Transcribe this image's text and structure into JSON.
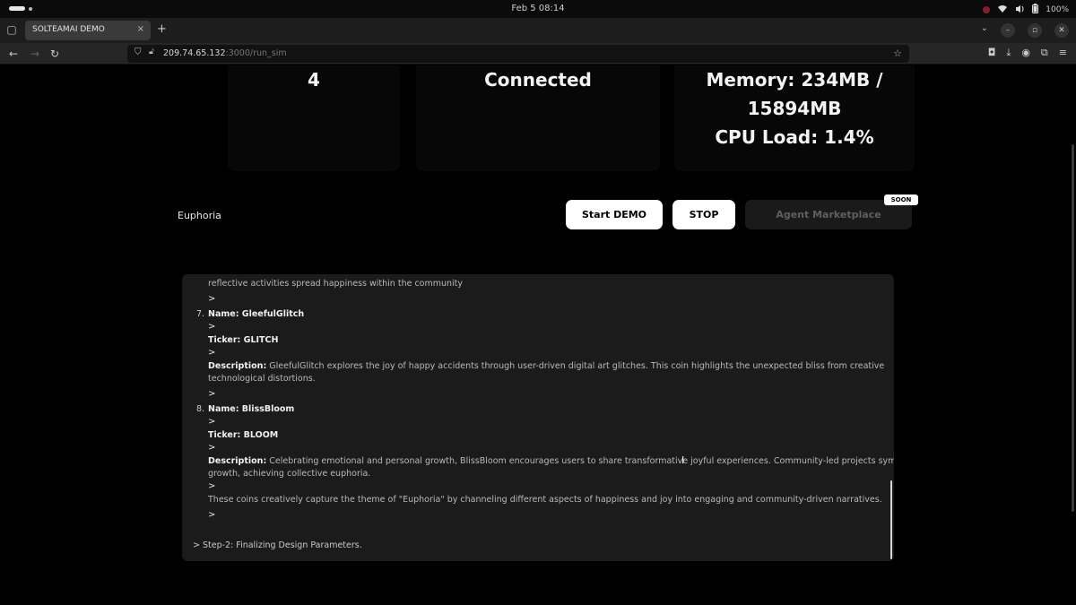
{
  "os": {
    "clock": "Feb 5  08:14",
    "battery": "100%"
  },
  "browser": {
    "tab_title": "SOLTEAMAI DEMO",
    "tab_close": "×",
    "new_tab": "+",
    "url_host": "209.74.65.132",
    "url_rest": ":3000/run_sim"
  },
  "stats": {
    "agents": "4",
    "connection": "Connected",
    "memory_line1": "Memory: 234MB /",
    "memory_line2": "15894MB",
    "cpu": "CPU Load: 1.4%"
  },
  "controls": {
    "topic": "Euphoria",
    "start_label": "Start DEMO",
    "stop_label": "STOP",
    "marketplace_label": "Agent Marketplace",
    "soon_badge": "SOON"
  },
  "log": {
    "line_top": "reflective activities spread happiness within the community",
    "gt": ">",
    "item7": {
      "num": "7.",
      "name_label": "Name: GleefulGlitch",
      "ticker_label": "Ticker: GLITCH",
      "desc_label": "Description:",
      "desc_line1": " GleefulGlitch explores the joy of happy accidents through user-driven digital art glitches. This coin highlights the unexpected bliss from creative",
      "desc_line2": "technological distortions."
    },
    "item8": {
      "num": "8.",
      "name_label": "Name: BlissBloom",
      "ticker_label": "Ticker: BLOOM",
      "desc_label": "Description:",
      "desc_line1": " Celebrating emotional and personal growth, BlissBloom encourages users to share transformative joyful experiences. Community-led projects symbolize",
      "desc_line2": "growth, achieving collective euphoria."
    },
    "summary": "These coins creatively capture the theme of \"Euphoria\" by channeling different aspects of happiness and joy into engaging and community-driven narratives.",
    "step": "> Step-2: Finalizing Design Parameters."
  }
}
